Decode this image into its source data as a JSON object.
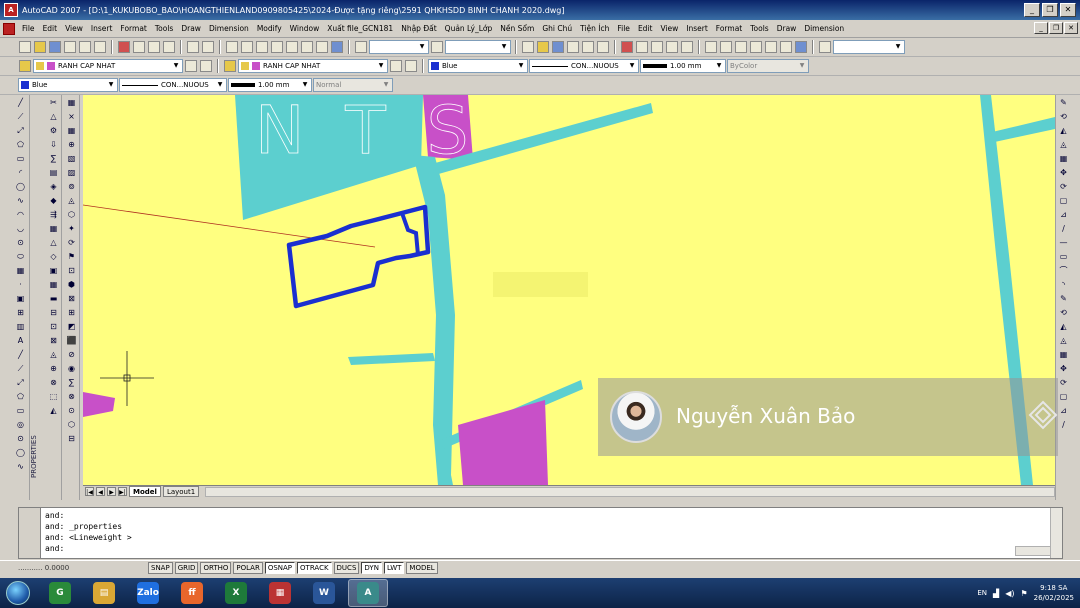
{
  "window": {
    "app_icon_label": "A",
    "title": "AutoCAD 2007 - [D:\\1_KUKUBOBO_BAO\\HOANGTHIENLAND0909805425\\2024-Được tặng riêng\\2591 QHKHSDD BINH CHANH 2020.dwg]",
    "buttons": {
      "minimize": "_",
      "restore": "❐",
      "close": "✕"
    }
  },
  "menubar": {
    "items": [
      "File",
      "Edit",
      "View",
      "Insert",
      "Format",
      "Tools",
      "Draw",
      "Dimension",
      "Modify",
      "Window",
      "Xuất file_GCN181",
      "Nhập Đất",
      "Quản Lý_Lớp",
      "Nền Sổm",
      "Ghi Chú",
      "Tiện Ích",
      "File",
      "Edit",
      "View",
      "Insert",
      "Format",
      "Tools",
      "Draw",
      "Dimension"
    ]
  },
  "toolbar2": {
    "text_style_combo": "",
    "dim_style_combo": "",
    "table_style_combo": ""
  },
  "toolbar3": {
    "layer_combo_1": "RANH CAP NHAT",
    "layer_combo_2": "RANH CAP NHAT",
    "color_combo": "Blue",
    "linetype_combo": "CON...NUOUS",
    "lineweight_combo": "1.00 mm",
    "plotstyle_combo": "ByColor"
  },
  "toolbar4": {
    "color_combo": "Blue",
    "linetype_combo": "CON...NUOUS",
    "lineweight_combo": "1.00 mm",
    "plotstyle_combo": "Normal"
  },
  "colors": {
    "canvas_yellow": "#ffff80",
    "road_teal": "#5ccfcf",
    "zone_magenta": "#c850c8",
    "parcel_blue": "#1a2fd0",
    "line_red": "#b03020"
  },
  "drawing": {
    "watermark_text": "N T S"
  },
  "tabs": {
    "nav": [
      "|◀",
      "◀",
      "▶",
      "▶|"
    ],
    "model": "Model",
    "layout1": "Layout1"
  },
  "side_labels": {
    "properties": "PROPERTIES"
  },
  "command": {
    "lines": [
      "and:",
      "and:  _properties",
      "and:  <Lineweight >",
      "and:"
    ]
  },
  "statusbar": {
    "coords": "...........  0.0000",
    "buttons": [
      {
        "label": "SNAP",
        "on": false
      },
      {
        "label": "GRID",
        "on": false
      },
      {
        "label": "ORTHO",
        "on": false
      },
      {
        "label": "POLAR",
        "on": false
      },
      {
        "label": "OSNAP",
        "on": true
      },
      {
        "label": "OTRACK",
        "on": true
      },
      {
        "label": "DUCS",
        "on": false
      },
      {
        "label": "DYN",
        "on": true
      },
      {
        "label": "LWT",
        "on": true
      },
      {
        "label": "MODEL",
        "on": false
      }
    ]
  },
  "overlay": {
    "person_name": "Nguyễn Xuân Bảo"
  },
  "taskbar": {
    "apps": [
      {
        "name": "chrome",
        "label": "G",
        "color": "#2a8a3a"
      },
      {
        "name": "explorer",
        "label": "▤",
        "color": "#d9a735"
      },
      {
        "name": "zalo",
        "label": "Zalo",
        "color": "#1f6fe0"
      },
      {
        "name": "firefox",
        "label": "ff",
        "color": "#e8662b"
      },
      {
        "name": "excel",
        "label": "X",
        "color": "#1e7a3a"
      },
      {
        "name": "cad-viewer",
        "label": "▦",
        "color": "#b33"
      },
      {
        "name": "word",
        "label": "W",
        "color": "#2a5699"
      },
      {
        "name": "autocad",
        "label": "A",
        "color": "#3a8a8a"
      }
    ],
    "language": "EN",
    "time": "9:18 SA",
    "date": "26/02/2025"
  }
}
